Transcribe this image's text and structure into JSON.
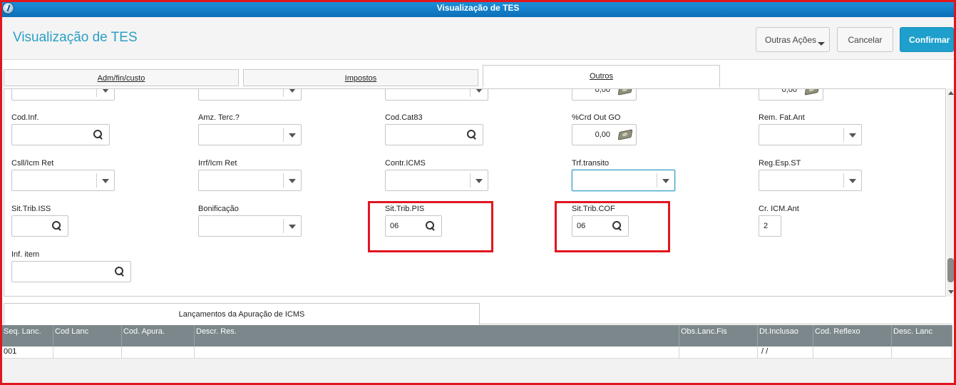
{
  "window": {
    "title": "Visualização de TES"
  },
  "header": {
    "title": "Visualização de TES",
    "buttons": {
      "outras": "Outras Ações",
      "cancel": "Cancelar",
      "confirm": "Confirmar"
    }
  },
  "tabs": [
    {
      "label": "Adm/fin/custo",
      "active": false
    },
    {
      "label": "Impostos",
      "active": false
    },
    {
      "label": "Outros",
      "active": true
    }
  ],
  "partial_row": {
    "value_4": "0,00",
    "value_5": "0,00"
  },
  "fields": {
    "cod_inf": {
      "label": "Cod.Inf.",
      "value": ""
    },
    "amz_terc": {
      "label": "Amz. Terc.?",
      "value": ""
    },
    "cod_cat83": {
      "label": "Cod.Cat83",
      "value": ""
    },
    "crd_out_go": {
      "label": "%Crd Out GO",
      "value": "0,00"
    },
    "rem_fat_ant": {
      "label": "Rem. Fat.Ant",
      "value": ""
    },
    "csll_icm_ret": {
      "label": "Csll/Icm Ret",
      "value": ""
    },
    "irrf_icm_ret": {
      "label": "Irrf/Icm Ret",
      "value": ""
    },
    "contr_icms": {
      "label": "Contr.ICMS",
      "value": ""
    },
    "trf_transito": {
      "label": "Trf.transito",
      "value": ""
    },
    "reg_esp_st": {
      "label": "Reg.Esp.ST",
      "value": ""
    },
    "sit_trib_iss": {
      "label": "Sit.Trib.ISS",
      "value": ""
    },
    "bonificacao": {
      "label": "Bonificação",
      "value": ""
    },
    "sit_trib_pis": {
      "label": "Sit.Trib.PIS",
      "value": "06"
    },
    "sit_trib_cof": {
      "label": "Sit.Trib.COF",
      "value": "06"
    },
    "cr_icm_ant": {
      "label": "Cr. ICM.Ant",
      "value": "2"
    },
    "inf_item": {
      "label": "Inf. item",
      "value": ""
    }
  },
  "bottom_tab": {
    "label": "Lançamentos da Apuração de ICMS"
  },
  "grid": {
    "columns": [
      "Seq. Lanc.",
      "Cod Lanc",
      "Cod. Apura.",
      "Descr. Res.",
      "Obs.Lanc.Fis",
      "Dt.Inclusao",
      "Cod. Reflexo",
      "Desc. Lanc"
    ],
    "rows": [
      [
        "001",
        "",
        "",
        "",
        "",
        " / /",
        "",
        ""
      ]
    ]
  },
  "colors": {
    "accent": "#2b9fc6",
    "confirm": "#1f9fcb",
    "highlight": "#e0161f",
    "grid_header": "#7b878b",
    "titlebar": "#0b6fb8"
  },
  "icons": [
    "app-globe-icon",
    "search-icon",
    "dropdown-arrow-icon",
    "money-calculator-icon"
  ]
}
